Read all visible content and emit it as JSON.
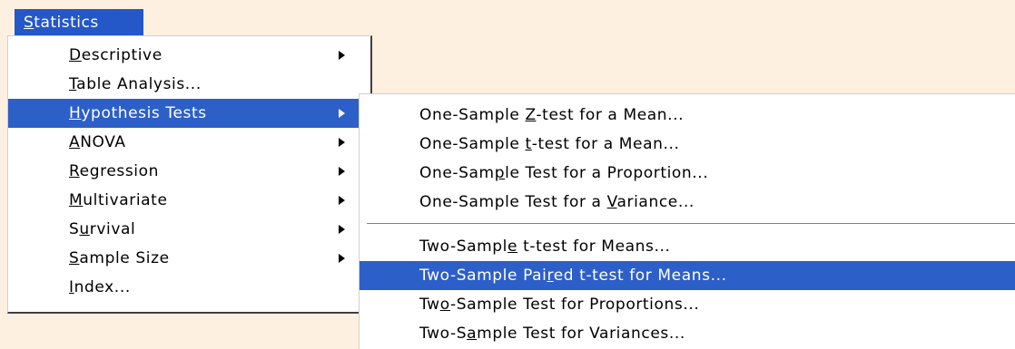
{
  "menubar": {
    "statistics": [
      "",
      "S",
      "tatistics"
    ]
  },
  "main_menu": [
    {
      "pre": "",
      "acc": "D",
      "post": "escriptive",
      "submenu": true
    },
    {
      "pre": "",
      "acc": "T",
      "post": "able Analysis...",
      "submenu": false
    },
    {
      "pre": "",
      "acc": "H",
      "post": "ypothesis Tests",
      "submenu": true,
      "highlighted": true
    },
    {
      "pre": "",
      "acc": "A",
      "post": "NOVA",
      "submenu": true
    },
    {
      "pre": "",
      "acc": "R",
      "post": "egression",
      "submenu": true
    },
    {
      "pre": "",
      "acc": "M",
      "post": "ultivariate",
      "submenu": true
    },
    {
      "pre": "S",
      "acc": "u",
      "post": "rvival",
      "submenu": true
    },
    {
      "pre": "",
      "acc": "S",
      "post": "ample Size",
      "submenu": true
    },
    {
      "pre": "",
      "acc": "I",
      "post": "ndex...",
      "submenu": false
    }
  ],
  "sub_menu": [
    {
      "pre": "One-Sample ",
      "acc": "Z",
      "post": "-test for a Mean..."
    },
    {
      "pre": "One-Sample ",
      "acc": "t",
      "post": "-test for a Mean..."
    },
    {
      "pre": "One-Sam",
      "acc": "p",
      "post": "le Test for a Proportion..."
    },
    {
      "pre": "One-Sample Test for a ",
      "acc": "V",
      "post": "ariance..."
    },
    {
      "pre": "Two-Sampl",
      "acc": "e",
      "post": " t-test for Means..."
    },
    {
      "pre": "Two-Sample Pai",
      "acc": "r",
      "post": "ed t-test for Means...",
      "highlighted": true
    },
    {
      "pre": "Tw",
      "acc": "o",
      "post": "-Sample Test for Proportions..."
    },
    {
      "pre": "Two-S",
      "acc": "a",
      "post": "mple Test for Variances..."
    }
  ],
  "colors": {
    "highlight": "#2d5fc9",
    "background": "#fdf0e0"
  }
}
